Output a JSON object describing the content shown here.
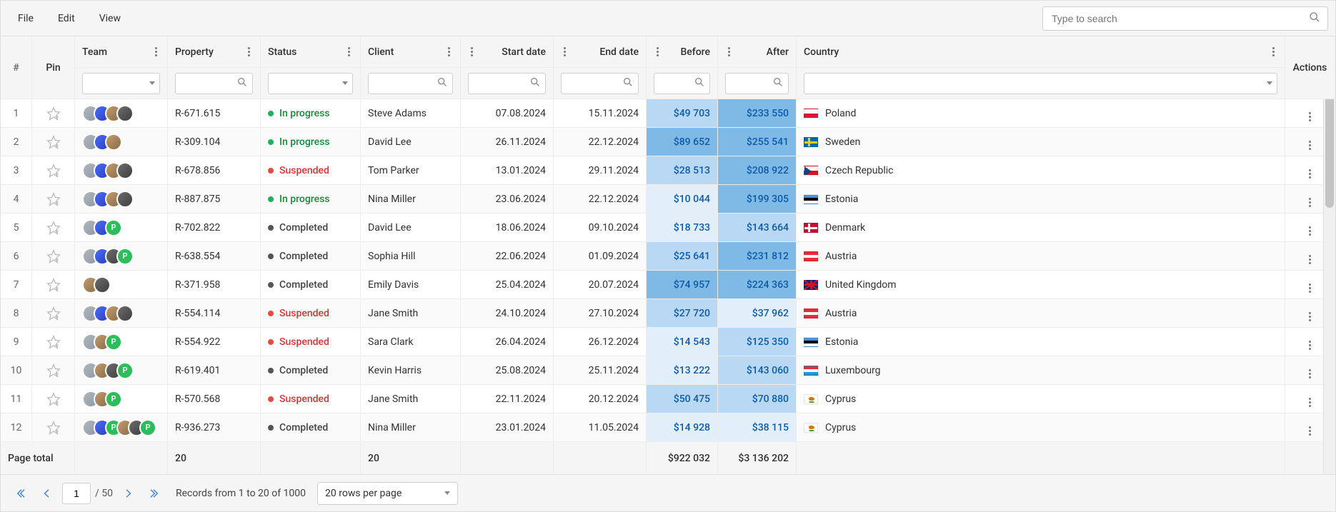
{
  "menu": {
    "file": "File",
    "edit": "Edit",
    "view": "View"
  },
  "search": {
    "placeholder": "Type to search"
  },
  "columns": {
    "idx": "#",
    "pin": "Pin",
    "team": "Team",
    "property": "Property",
    "status": "Status",
    "client": "Client",
    "start": "Start date",
    "end": "End date",
    "before": "Before",
    "after": "After",
    "country": "Country",
    "actions": "Actions"
  },
  "status_labels": {
    "progress": "In progress",
    "suspended": "Suspended",
    "completed": "Completed"
  },
  "rows": [
    {
      "idx": 1,
      "team": [
        "a",
        "b",
        "c",
        "d"
      ],
      "property": "R-671.615",
      "status": "progress",
      "client": "Steve Adams",
      "start": "07.08.2024",
      "end": "15.11.2024",
      "before": "$49 703",
      "after": "$233 550",
      "country": "Poland",
      "flag": "pl",
      "b_lvl": 2,
      "a_lvl": 3
    },
    {
      "idx": 2,
      "team": [
        "a",
        "b",
        "c"
      ],
      "property": "R-309.104",
      "status": "progress",
      "client": "David Lee",
      "start": "26.11.2024",
      "end": "22.12.2024",
      "before": "$89 652",
      "after": "$255 541",
      "country": "Sweden",
      "flag": "se",
      "b_lvl": 3,
      "a_lvl": 3
    },
    {
      "idx": 3,
      "team": [
        "a",
        "b",
        "c",
        "d"
      ],
      "property": "R-678.856",
      "status": "suspended",
      "client": "Tom Parker",
      "start": "13.01.2024",
      "end": "29.11.2024",
      "before": "$28 513",
      "after": "$208 922",
      "country": "Czech Republic",
      "flag": "cz",
      "b_lvl": 2,
      "a_lvl": 3
    },
    {
      "idx": 4,
      "team": [
        "a",
        "b",
        "c",
        "d"
      ],
      "property": "R-887.875",
      "status": "progress",
      "client": "Nina Miller",
      "start": "23.06.2024",
      "end": "22.12.2024",
      "before": "$10 044",
      "after": "$199 305",
      "country": "Estonia",
      "flag": "ee",
      "b_lvl": 1,
      "a_lvl": 3
    },
    {
      "idx": 5,
      "team": [
        "a",
        "b",
        "p"
      ],
      "property": "R-702.822",
      "status": "completed",
      "client": "David Lee",
      "start": "18.06.2024",
      "end": "09.10.2024",
      "before": "$18 733",
      "after": "$143 664",
      "country": "Denmark",
      "flag": "dk",
      "b_lvl": 1,
      "a_lvl": 2
    },
    {
      "idx": 6,
      "team": [
        "a",
        "b",
        "d",
        "p"
      ],
      "property": "R-638.554",
      "status": "completed",
      "client": "Sophia Hill",
      "start": "22.06.2024",
      "end": "01.09.2024",
      "before": "$25 641",
      "after": "$231 812",
      "country": "Austria",
      "flag": "at",
      "b_lvl": 2,
      "a_lvl": 3
    },
    {
      "idx": 7,
      "team": [
        "c",
        "d"
      ],
      "property": "R-371.958",
      "status": "completed",
      "client": "Emily Davis",
      "start": "25.04.2024",
      "end": "20.07.2024",
      "before": "$74 957",
      "after": "$224 363",
      "country": "United Kingdom",
      "flag": "gb",
      "b_lvl": 3,
      "a_lvl": 3
    },
    {
      "idx": 8,
      "team": [
        "a",
        "b",
        "c",
        "d"
      ],
      "property": "R-554.114",
      "status": "suspended",
      "client": "Jane Smith",
      "start": "24.10.2024",
      "end": "27.10.2024",
      "before": "$27 720",
      "after": "$37 962",
      "country": "Austria",
      "flag": "at",
      "b_lvl": 2,
      "a_lvl": 1
    },
    {
      "idx": 9,
      "team": [
        "a",
        "c",
        "p"
      ],
      "property": "R-554.922",
      "status": "suspended",
      "client": "Sara Clark",
      "start": "26.04.2024",
      "end": "26.12.2024",
      "before": "$14 543",
      "after": "$125 350",
      "country": "Estonia",
      "flag": "ee",
      "b_lvl": 1,
      "a_lvl": 2
    },
    {
      "idx": 10,
      "team": [
        "a",
        "c",
        "d",
        "p"
      ],
      "property": "R-619.401",
      "status": "completed",
      "client": "Kevin Harris",
      "start": "25.08.2024",
      "end": "25.11.2024",
      "before": "$13 222",
      "after": "$143 060",
      "country": "Luxembourg",
      "flag": "lu",
      "b_lvl": 1,
      "a_lvl": 2
    },
    {
      "idx": 11,
      "team": [
        "a",
        "c",
        "p"
      ],
      "property": "R-570.568",
      "status": "suspended",
      "client": "Jane Smith",
      "start": "22.11.2024",
      "end": "20.12.2024",
      "before": "$50 475",
      "after": "$70 880",
      "country": "Cyprus",
      "flag": "cy",
      "b_lvl": 2,
      "a_lvl": 2
    },
    {
      "idx": 12,
      "team": [
        "a",
        "b",
        "p",
        "c",
        "d",
        "p"
      ],
      "property": "R-936.273",
      "status": "completed",
      "client": "Nina Miller",
      "start": "23.01.2024",
      "end": "11.05.2024",
      "before": "$14 928",
      "after": "$38 115",
      "country": "Cyprus",
      "flag": "cy",
      "b_lvl": 1,
      "a_lvl": 1
    }
  ],
  "totals": {
    "label": "Page total",
    "property": "20",
    "client": "20",
    "before": "$922 032",
    "after": "$3 136 202"
  },
  "pager": {
    "page": "1",
    "total_pages": "/ 50",
    "records": "Records from 1 to 20 of 1000",
    "rows_per_page": "20 rows per page"
  }
}
